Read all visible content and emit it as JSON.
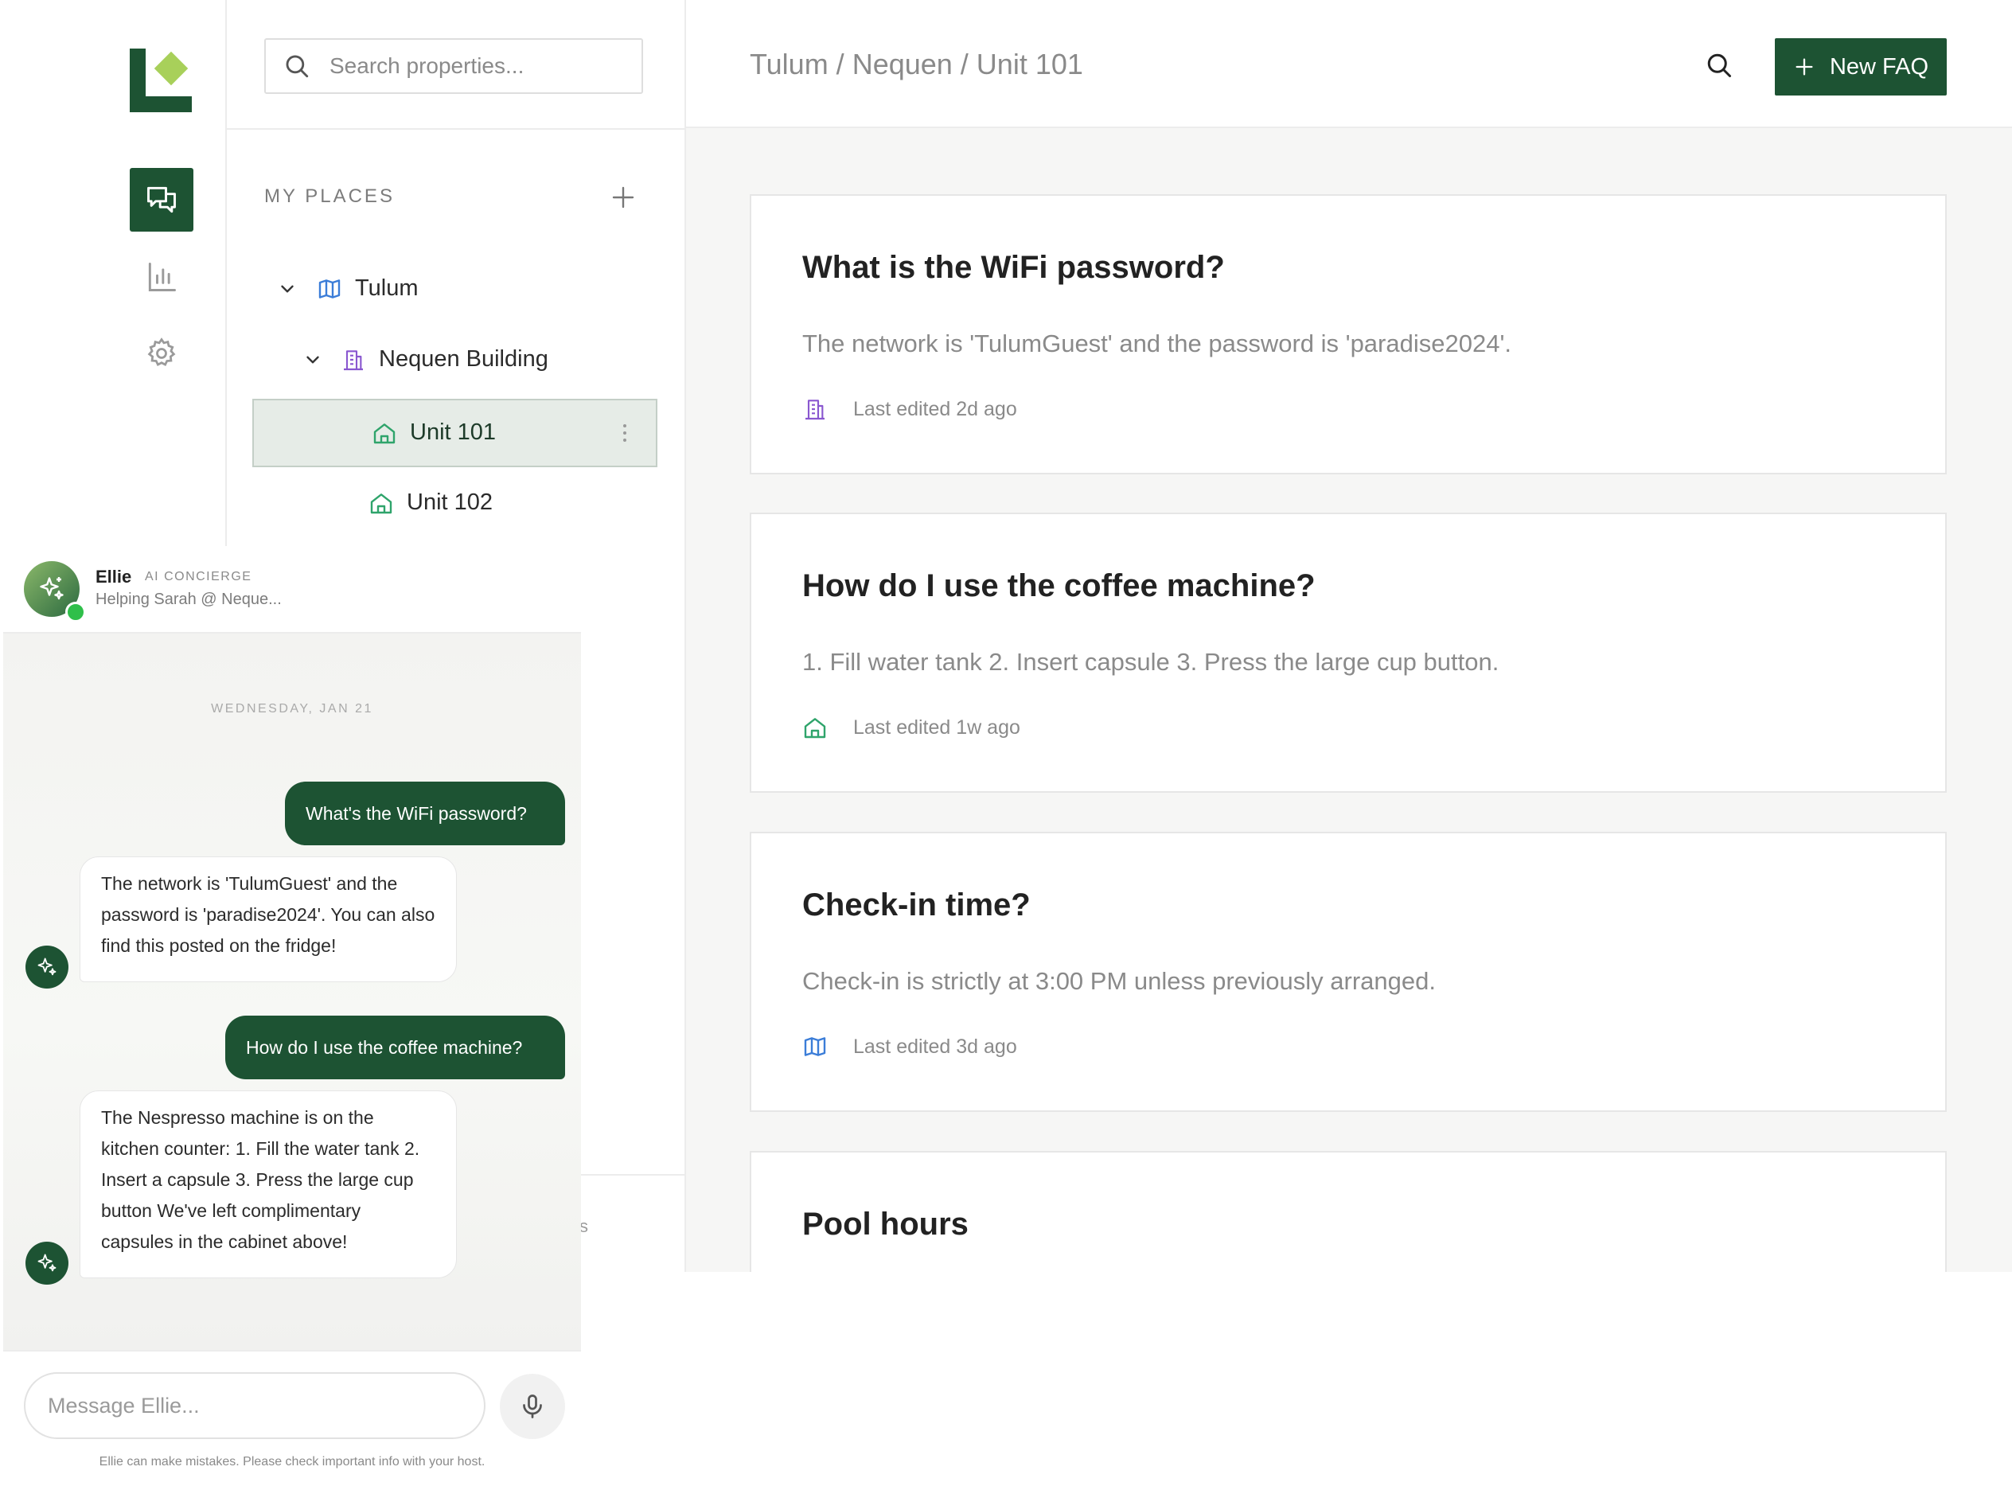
{
  "search": {
    "placeholder": "Search properties..."
  },
  "places": {
    "title": "MY PLACES",
    "tree": [
      {
        "label": "Tulum",
        "icon": "map-icon"
      },
      {
        "label": "Nequen Building",
        "icon": "building-icon"
      },
      {
        "label": "Unit 101",
        "icon": "home-icon",
        "selected": true
      },
      {
        "label": "Unit 102",
        "icon": "home-icon"
      }
    ],
    "stray_text": "s"
  },
  "header": {
    "breadcrumb": "Tulum / Nequen / Unit 101",
    "new_faq_label": "New FAQ"
  },
  "faqs": [
    {
      "question": "What is the WiFi password?",
      "answer": "The network is 'TulumGuest' and the password is 'paradise2024'.",
      "meta": "Last edited 2d ago",
      "icon": "building-icon"
    },
    {
      "question": "How do I use the coffee machine?",
      "answer": "1. Fill water tank 2. Insert capsule 3. Press the large cup button.",
      "meta": "Last edited 1w ago",
      "icon": "home-icon"
    },
    {
      "question": "Check-in time?",
      "answer": "Check-in is strictly at 3:00 PM unless previously arranged.",
      "meta": "Last edited 3d ago",
      "icon": "map-icon"
    },
    {
      "question": "Pool hours",
      "answer": "",
      "meta": "",
      "icon": ""
    }
  ],
  "chat": {
    "name": "Ellie",
    "role": "AI CONCIERGE",
    "subtitle": "Helping Sarah @ Neque...",
    "date": "WEDNESDAY, JAN 21",
    "messages": [
      {
        "from": "user",
        "text": "What's the WiFi password?"
      },
      {
        "from": "bot",
        "text": "The network is 'TulumGuest' and the password is 'paradise2024'. You can also find this posted on the fridge!"
      },
      {
        "from": "user",
        "text": "How do I use the coffee machine?"
      },
      {
        "from": "bot",
        "text": "The Nespresso machine is on the kitchen counter: 1. Fill the water tank 2. Insert a capsule 3. Press the large cup button We've left complimentary capsules in the cabinet above!"
      }
    ],
    "input_placeholder": "Message Ellie...",
    "disclaimer": "Ellie can make mistakes. Please check important info with your host."
  },
  "colors": {
    "brand": "#1d5333",
    "logo_accent": "#a8d05a",
    "map_icon": "#3b7dd8",
    "building_icon": "#8a57d0",
    "home_icon": "#2fa46b"
  }
}
